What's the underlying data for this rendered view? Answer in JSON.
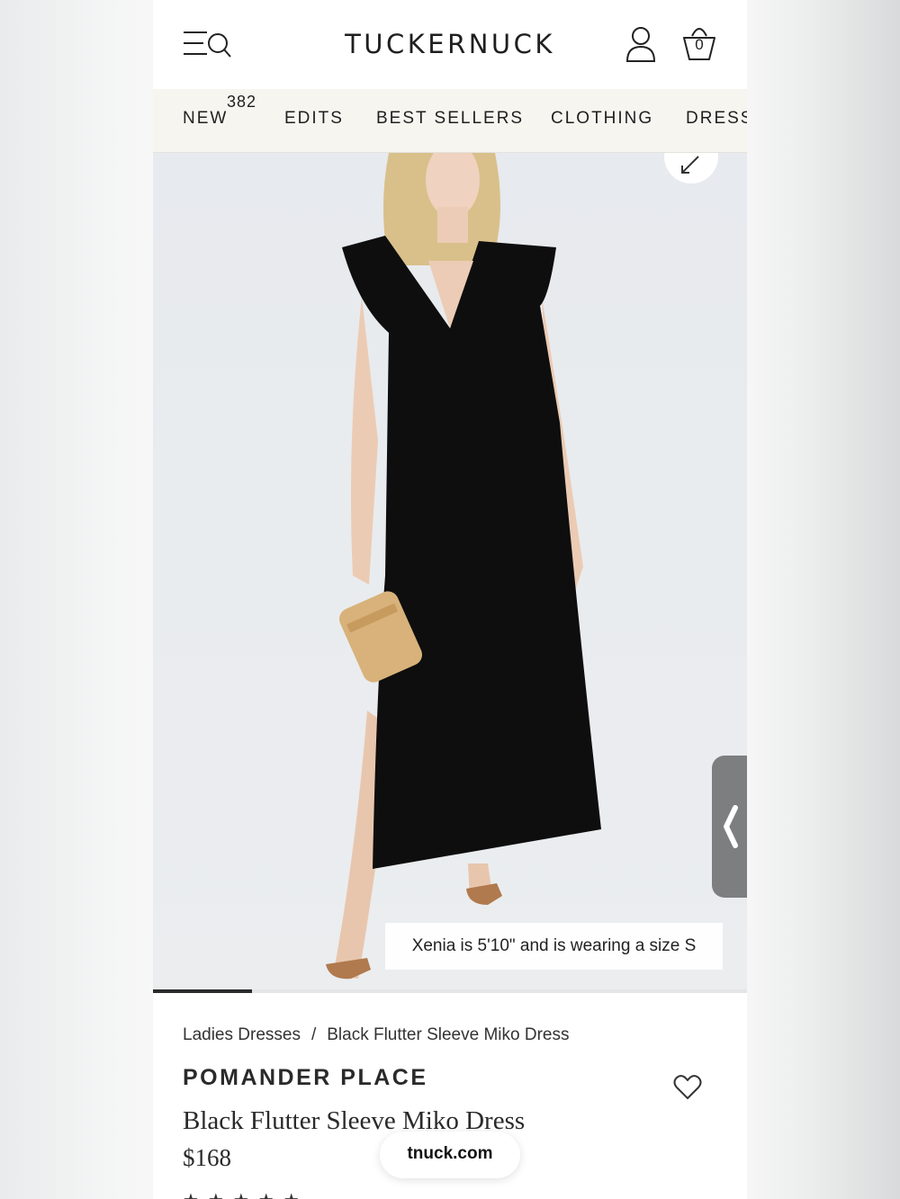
{
  "header": {
    "logo": "TUCKERNUCK",
    "bag_count": "0"
  },
  "nav": {
    "items": [
      {
        "label": "NEW",
        "badge": "382"
      },
      {
        "label": "EDITS"
      },
      {
        "label": "BEST SELLERS"
      },
      {
        "label": "CLOTHING"
      },
      {
        "label": "DRESS"
      }
    ]
  },
  "gallery": {
    "size_caption": "Xenia is 5'10\" and is wearing a size S",
    "progress": 0.167
  },
  "product": {
    "breadcrumb": [
      "Ladies Dresses",
      "/",
      "Black Flutter Sleeve Miko Dress"
    ],
    "brand": "POMANDER PLACE",
    "name": "Black Flutter Sleeve Miko Dress",
    "price": "$168"
  },
  "url_pill": "tnuck.com",
  "colors": {
    "nav_background": "#f6f5ef",
    "text": "#1f1f1f",
    "image_background": "#e9ecef"
  }
}
